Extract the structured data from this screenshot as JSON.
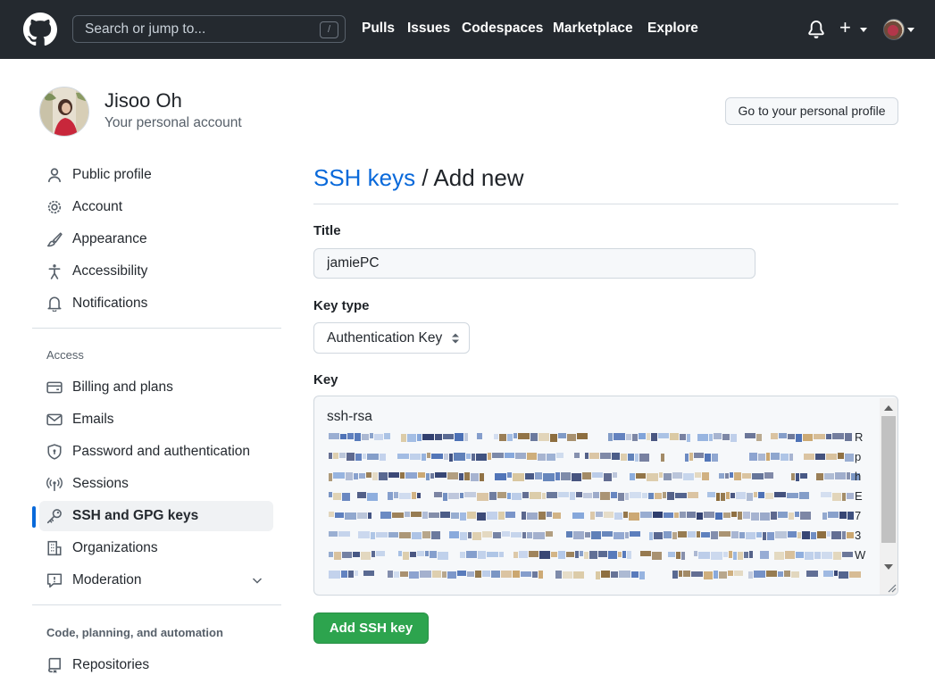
{
  "header": {
    "search_placeholder": "Search or jump to...",
    "search_shortcut": "/",
    "nav": [
      "Pulls",
      "Issues",
      "Codespaces",
      "Marketplace",
      "Explore"
    ],
    "plus": "+"
  },
  "account": {
    "name": "Jisoo Oh",
    "subtitle": "Your personal account",
    "profile_button": "Go to your personal profile"
  },
  "sidebar": {
    "items_top": [
      {
        "label": "Public profile",
        "icon": "person-icon"
      },
      {
        "label": "Account",
        "icon": "gear-icon"
      },
      {
        "label": "Appearance",
        "icon": "paintbrush-icon"
      },
      {
        "label": "Accessibility",
        "icon": "accessibility-icon"
      },
      {
        "label": "Notifications",
        "icon": "bell-icon"
      }
    ],
    "access_heading": "Access",
    "items_access": [
      {
        "label": "Billing and plans",
        "icon": "credit-card-icon"
      },
      {
        "label": "Emails",
        "icon": "mail-icon"
      },
      {
        "label": "Password and authentication",
        "icon": "shield-lock-icon"
      },
      {
        "label": "Sessions",
        "icon": "broadcast-icon"
      },
      {
        "label": "SSH and GPG keys",
        "icon": "key-icon",
        "active": true
      },
      {
        "label": "Organizations",
        "icon": "organization-icon"
      },
      {
        "label": "Moderation",
        "icon": "report-icon",
        "expandable": true
      }
    ],
    "automation_heading": "Code, planning, and automation",
    "items_automation": [
      {
        "label": "Repositories",
        "icon": "repo-icon"
      }
    ]
  },
  "main": {
    "breadcrumb_link": "SSH keys",
    "breadcrumb_sep": " / ",
    "breadcrumb_current": "Add new",
    "title_label": "Title",
    "title_value": "jamiePC",
    "key_type_label": "Key type",
    "key_type_value": "Authentication Key",
    "key_label": "Key",
    "key_first_line": "ssh-rsa",
    "key_trailing_chars": [
      "R",
      "p",
      "h",
      "E",
      "7",
      "3",
      "W"
    ],
    "submit_button": "Add SSH key"
  },
  "colors": {
    "header_bg": "#24292f",
    "link": "#0969da",
    "primary_button": "#2da44e",
    "active_indicator": "#0969da"
  }
}
